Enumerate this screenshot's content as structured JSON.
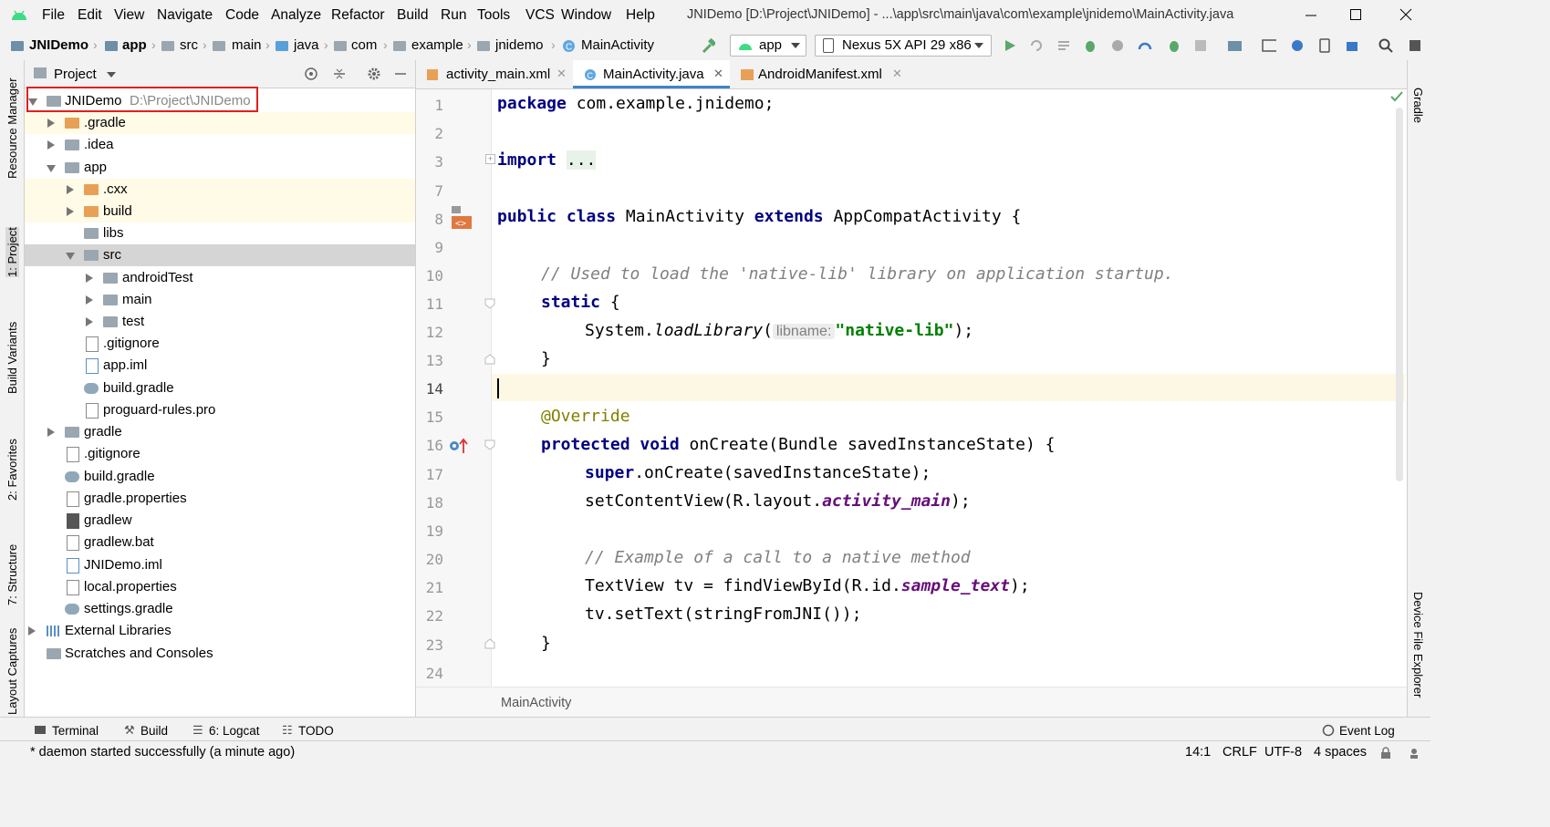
{
  "menubar": {
    "items": [
      "File",
      "Edit",
      "View",
      "Navigate",
      "Code",
      "Analyze",
      "Refactor",
      "Build",
      "Run",
      "Tools",
      "VCS",
      "Window",
      "Help"
    ],
    "window_title": "JNIDemo [D:\\Project\\JNIDemo] - ...\\app\\src\\main\\java\\com\\example\\jnidemo\\MainActivity.java"
  },
  "navbar": {
    "breadcrumbs": [
      "JNIDemo",
      "app",
      "src",
      "main",
      "java",
      "com",
      "example",
      "jnidemo",
      "MainActivity"
    ],
    "run_config": "app",
    "device": "Nexus 5X API 29 x86"
  },
  "left_strip": [
    "Resource Manager",
    "1: Project",
    "Build Variants",
    "2: Favorites",
    "7: Structure",
    "Layout Captures"
  ],
  "right_strip": [
    "Gradle",
    "Device File Explorer"
  ],
  "project_panel": {
    "title": "Project",
    "root": {
      "name": "JNIDemo",
      "path": "D:\\Project\\JNIDemo"
    },
    "items": [
      {
        "label": ".gradle"
      },
      {
        "label": ".idea"
      },
      {
        "label": "app"
      },
      {
        "label": ".cxx"
      },
      {
        "label": "build"
      },
      {
        "label": "libs"
      },
      {
        "label": "src"
      },
      {
        "label": "androidTest"
      },
      {
        "label": "main"
      },
      {
        "label": "test"
      },
      {
        "label": ".gitignore"
      },
      {
        "label": "app.iml"
      },
      {
        "label": "build.gradle"
      },
      {
        "label": "proguard-rules.pro"
      },
      {
        "label": "gradle"
      },
      {
        "label": ".gitignore"
      },
      {
        "label": "build.gradle"
      },
      {
        "label": "gradle.properties"
      },
      {
        "label": "gradlew"
      },
      {
        "label": "gradlew.bat"
      },
      {
        "label": "JNIDemo.iml"
      },
      {
        "label": "local.properties"
      },
      {
        "label": "settings.gradle"
      },
      {
        "label": "External Libraries"
      },
      {
        "label": "Scratches and Consoles"
      }
    ]
  },
  "editor": {
    "tabs": [
      "activity_main.xml",
      "MainActivity.java",
      "AndroidManifest.xml"
    ],
    "active_tab": "MainActivity.java",
    "line_numbers": [
      "1",
      "2",
      "3",
      "7",
      "8",
      "9",
      "10",
      "11",
      "12",
      "13",
      "14",
      "15",
      "16",
      "17",
      "18",
      "19",
      "20",
      "21",
      "22",
      "23",
      "24"
    ],
    "code": {
      "l1a": "package",
      "l1b": " com.example.jnidemo;",
      "l3a": "import",
      "l3b": "...",
      "l8a": "public class",
      "l8b": " MainActivity ",
      "l8c": "extends",
      "l8d": " AppCompatActivity {",
      "l10": "// Used to load the 'native-lib' library on application startup.",
      "l11a": "static",
      "l11b": " {",
      "l12a": "System.",
      "l12b": "loadLibrary",
      "l12c": "(",
      "l12hint": "libname:",
      "l12d": "\"native-lib\"",
      "l12e": ");",
      "l13": "}",
      "l15": "@Override",
      "l16a": "protected void",
      "l16b": " onCreate(Bundle savedInstanceState) {",
      "l17a": "super",
      "l17b": ".onCreate(savedInstanceState);",
      "l18a": "setContentView(R.layout.",
      "l18b": "activity_main",
      "l18c": ");",
      "l20": "// Example of a call to a native method",
      "l21a": "TextView tv = findViewById(R.id.",
      "l21b": "sample_text",
      "l21c": ");",
      "l22": "tv.setText(stringFromJNI());",
      "l23": "}"
    },
    "breadcrumb": "MainActivity"
  },
  "bottom_tools": [
    "Terminal",
    "Build",
    "6: Logcat",
    "TODO",
    "Event Log"
  ],
  "status": {
    "message": "* daemon started successfully (a minute ago)",
    "position": "14:1",
    "line_sep": "CRLF",
    "encoding": "UTF-8",
    "indent": "4 spaces"
  },
  "colors": {
    "highlight_box": "#e02020",
    "android_green": "#3ddc84",
    "run_green": "#59a869"
  }
}
